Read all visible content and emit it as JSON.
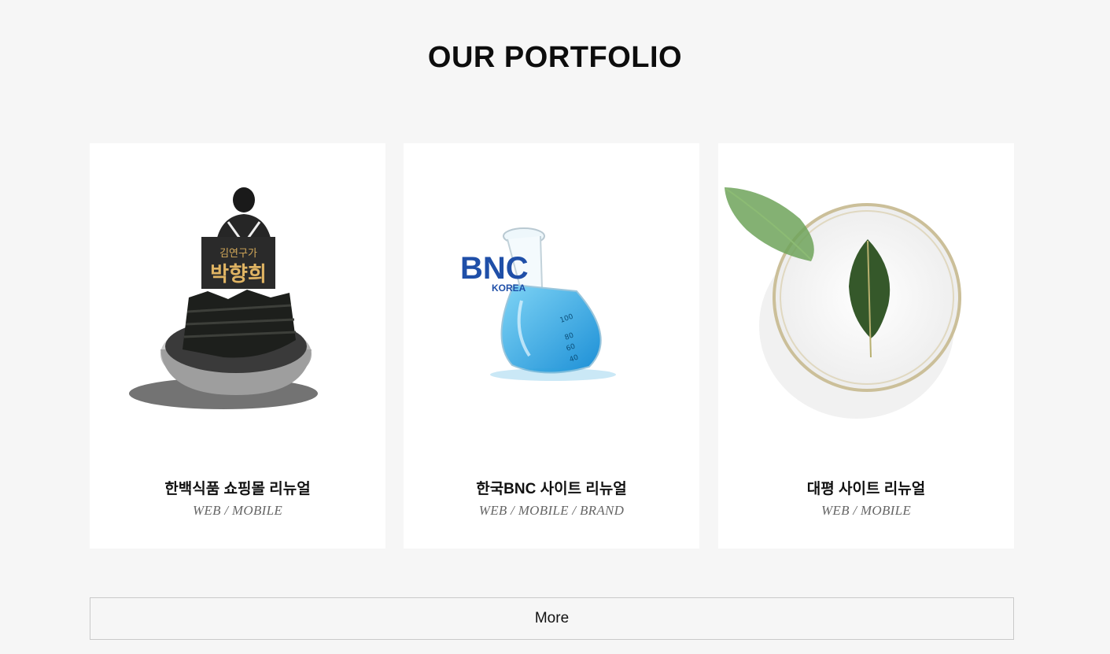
{
  "section": {
    "title": "OUR PORTFOLIO"
  },
  "portfolio": {
    "items": [
      {
        "title": "한백식품 쇼핑몰 리뉴얼",
        "tags": "WEB / MOBILE",
        "image": "seaweed-product-icon",
        "logo_lines": [
          "김연구가",
          "박향희"
        ]
      },
      {
        "title": "한국BNC 사이트 리뉴얼",
        "tags": "WEB / MOBILE / BRAND",
        "image": "flask-icon",
        "logo_lines": [
          "BNC",
          "KOREA"
        ],
        "flask_marks": [
          "100",
          "80",
          "60",
          "40"
        ]
      },
      {
        "title": "대평 사이트 리뉴얼",
        "tags": "WEB / MOBILE",
        "image": "leaf-dish-icon"
      }
    ]
  },
  "more_button": {
    "label": "More"
  },
  "colors": {
    "background": "#f6f6f6",
    "card": "#ffffff",
    "bnc_blue": "#1f4fa8",
    "flask_liquid": "#29a8e0",
    "leaf_green": "#4d7a3c"
  }
}
